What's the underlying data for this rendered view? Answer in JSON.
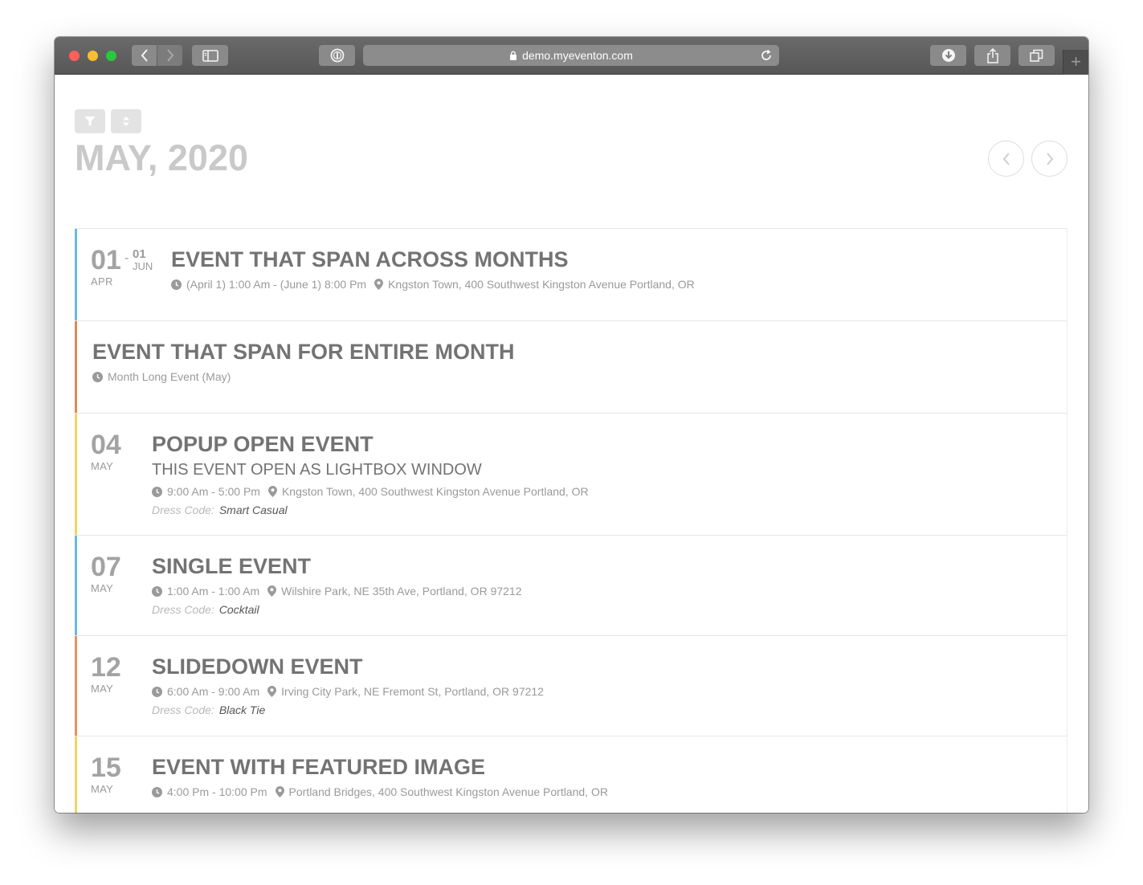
{
  "browser": {
    "url": "demo.myeventon.com",
    "new_tab_glyph": "+",
    "icons": {
      "back": "chevron-left-icon",
      "forward": "chevron-right-icon",
      "sidebar": "sidebar-icon",
      "password": "password-manager-icon",
      "lock": "lock-icon",
      "reload": "reload-icon",
      "download": "download-icon",
      "share": "share-icon",
      "tabs": "tabs-icon"
    }
  },
  "calendar": {
    "month_title": "MAY, 2020",
    "controls": {
      "filter_icon": "filter-icon",
      "sort_icon": "sort-icon"
    },
    "nav": {
      "prev_icon": "chevron-left-icon",
      "next_icon": "chevron-right-icon"
    }
  },
  "events": [
    {
      "color": "#6fb9d6",
      "day": "01",
      "month": "APR",
      "end_day": "01",
      "end_month": "JUN",
      "range_separator": "-",
      "title": "EVENT THAT SPAN ACROSS MONTHS",
      "time": "(April 1) 1:00 Am - (June 1) 8:00 Pm",
      "location": "Kngston Town, 400 Southwest Kingston Avenue Portland, OR"
    },
    {
      "color": "#d98b5f",
      "title": "EVENT THAT SPAN FOR ENTIRE MONTH",
      "time": "Month Long Event (May)"
    },
    {
      "color": "#ecd665",
      "day": "04",
      "month": "MAY",
      "title": "POPUP OPEN EVENT",
      "subtitle": "THIS EVENT OPEN AS LIGHTBOX WINDOW",
      "time": "9:00 Am - 5:00 Pm",
      "location": "Kngston Town, 400 Southwest Kingston Avenue Portland, OR",
      "dress_label": "Dress Code:",
      "dress_value": "Smart Casual"
    },
    {
      "color": "#6fb9d6",
      "day": "07",
      "month": "MAY",
      "title": "SINGLE EVENT",
      "time": "1:00 Am - 1:00 Am",
      "location": "Wilshire Park, NE 35th Ave, Portland, OR 97212",
      "dress_label": "Dress Code:",
      "dress_value": "Cocktail"
    },
    {
      "color": "#e0955f",
      "day": "12",
      "month": "MAY",
      "title": "SLIDEDOWN EVENT",
      "time": "6:00 Am - 9:00 Am",
      "location": "Irving City Park, NE Fremont St, Portland, OR 97212",
      "dress_label": "Dress Code:",
      "dress_value": "Black Tie"
    },
    {
      "color": "#ecd665",
      "day": "15",
      "month": "MAY",
      "title": "EVENT WITH FEATURED IMAGE",
      "time": "4:00 Pm - 10:00 Pm",
      "location": "Portland Bridges, 400 Southwest Kingston Avenue Portland, OR"
    },
    {
      "color": "#ecd665"
    }
  ]
}
